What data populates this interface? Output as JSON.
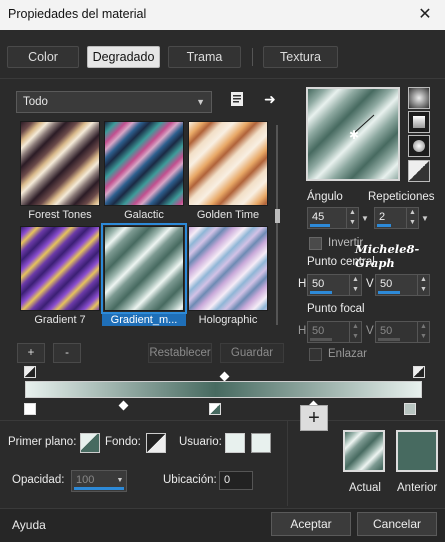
{
  "window": {
    "title": "Propiedades del material",
    "close_icon": "close-icon"
  },
  "tabs": [
    {
      "label": "Color",
      "active": false
    },
    {
      "label": "Degradado",
      "active": true
    },
    {
      "label": "Trama",
      "active": false
    },
    {
      "label": "Textura",
      "active": false
    }
  ],
  "filter": {
    "selected": "Todo"
  },
  "swatches": [
    {
      "label": "Forest Tones",
      "selected": false
    },
    {
      "label": "Galactic",
      "selected": false
    },
    {
      "label": "Golden Time",
      "selected": false
    },
    {
      "label": "Gradient 7",
      "selected": false
    },
    {
      "label": "Gradient_m...",
      "selected": true
    },
    {
      "label": "Holographic",
      "selected": false
    }
  ],
  "buttons": {
    "add": "+",
    "remove": "-",
    "reset": "Restablecer",
    "save": "Guardar",
    "accept": "Aceptar",
    "cancel": "Cancelar",
    "help": "Ayuda",
    "add_swatch": "+"
  },
  "angle": {
    "label": "Ángulo",
    "value": "45"
  },
  "repeats": {
    "label": "Repeticiones",
    "value": "2"
  },
  "invert": {
    "label": "Invertir",
    "checked": false
  },
  "watermark": "Michele8-Graph",
  "center_point": {
    "label": "Punto central",
    "h_label": "H",
    "h_value": "50",
    "v_label": "V",
    "v_value": "50"
  },
  "focal_point": {
    "label": "Punto focal",
    "h_label": "H",
    "h_value": "50",
    "v_label": "V",
    "v_value": "50"
  },
  "link": {
    "label": "Enlazar",
    "checked": false
  },
  "colors": {
    "gradient_dark": "#476a60",
    "gradient_light": "#e8f1ee",
    "foreground": "#476a60",
    "user": "#e8f1ee",
    "accent": "#2d8ad8"
  },
  "bottom": {
    "foreground_label": "Primer plano:",
    "background_label": "Fondo:",
    "user_label": "Usuario:",
    "opacity_label": "Opacidad:",
    "opacity_value": "100",
    "location_label": "Ubicación:",
    "location_value": "0",
    "current_label": "Actual",
    "previous_label": "Anterior"
  }
}
